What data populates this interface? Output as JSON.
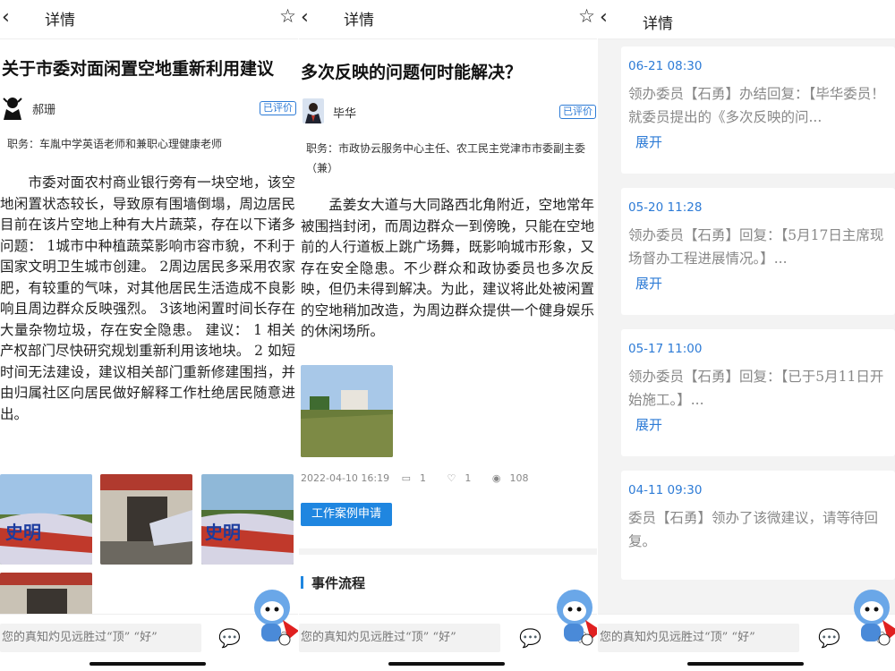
{
  "nav": {
    "back_icon": "chevron-left-icon",
    "title": "详情",
    "star_icon": "star-outline-icon"
  },
  "panel1": {
    "title": "关于市委对面闲置空地重新利用建议",
    "author": "郝珊",
    "badge": "已评价",
    "duty": "职务：车胤中学英语老师和兼职心理健康老师",
    "body": "　　市委对面农村商业银行旁有一块空地，该空地闲置状态较长，导致原有围墙倒塌，周边居民目前在该片空地上种有大片蔬菜，存在以下诸多问题： 1城市中种植蔬菜影响市容市貌，不利于国家文明卫生城市创建。 2周边居民多采用农家肥，有较重的气味，对其他居民生活造成不良影响且周边群众反映强烈。 3该地闲置时间长存在大量杂物垃圾，存在安全隐患。 建议： 1 相关产权部门尽快研究规划重新利用该地块。 2 如短时间无法建设，建议相关部门重新修建围挡，并由归属社区向居民做好解释工作杜绝居民随意进出。"
  },
  "panel2": {
    "title": "多次反映的问题何时能解决？",
    "author": "毕华",
    "badge": "已评价",
    "duty": "职务：市政协云服务中心主任、农工民主党津市市委副主委（兼）",
    "body": "　　孟姜女大道与大同路西北角附近，空地常年被围挡封闭，而周边群众一到傍晚，只能在空地前的人行道板上跳广场舞，既影响城市形象，又存在安全隐患。不少群众和政协委员也多次反映，但仍未得到解决。为此，建议将此处被闲置的空地稍加改造，为周边群众提供一个健身娱乐的休闲场所。",
    "date": "2022-04-10 16:19",
    "comments": "1",
    "likes": "1",
    "views": "108",
    "apply_button": "工作案例申请",
    "section": "事件流程"
  },
  "panel3": {
    "items": [
      {
        "time": "06-21 08:30",
        "text": "领办委员【石勇】办结回复：【毕华委员！就委员提出的《多次反映的问...",
        "expand": "展开"
      },
      {
        "time": "05-20 11:28",
        "text": "领办委员【石勇】回复：【5月17日主席现场督办工程进展情况。】...",
        "expand": "展开"
      },
      {
        "time": "05-17 11:00",
        "text": "领办委员【石勇】回复：【已于5月11日开始施工。】...",
        "expand": "展开"
      },
      {
        "time": "04-11 09:30",
        "text": "委员【石勇】领办了该微建议，请等待回复。"
      }
    ]
  },
  "bottom": {
    "placeholder": "您的真知灼见远胜过“顶” “好”"
  },
  "colors": {
    "accent": "#1f86e0",
    "link": "#2d7bd6"
  }
}
